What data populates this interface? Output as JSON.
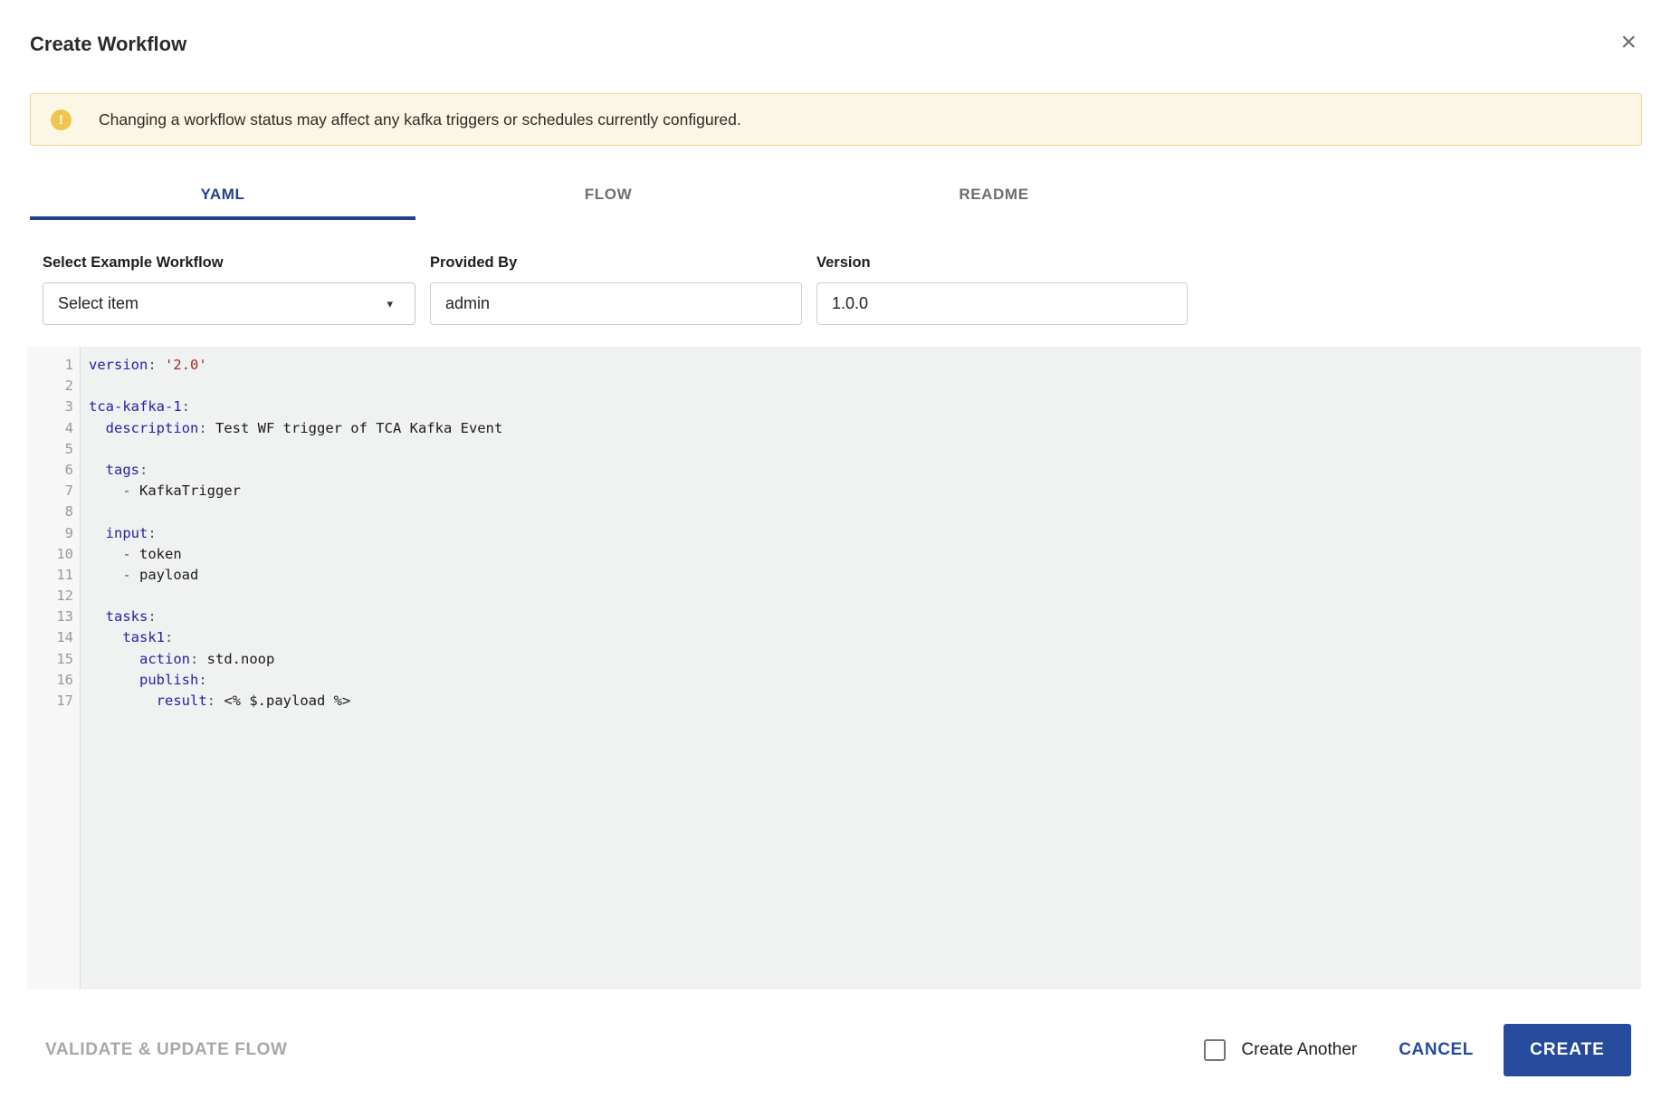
{
  "modal": {
    "title": "Create Workflow",
    "close_icon": "×"
  },
  "warning": {
    "icon": "!",
    "text": "Changing a workflow status may affect any kafka triggers or schedules currently configured."
  },
  "tabs": [
    {
      "label": "YAML",
      "active": true
    },
    {
      "label": "FLOW",
      "active": false
    },
    {
      "label": "README",
      "active": false
    }
  ],
  "form": {
    "example_workflow": {
      "label": "Select Example Workflow",
      "value": "Select item",
      "caret": "▾"
    },
    "provided_by": {
      "label": "Provided By",
      "value": "admin"
    },
    "version": {
      "label": "Version",
      "value": "1.0.0"
    }
  },
  "editor": {
    "lines": [
      {
        "num": "1",
        "tokens": [
          {
            "t": "version",
            "c": "key"
          },
          {
            "t": ":",
            "c": "meta"
          },
          {
            "t": " ",
            "c": "plain"
          },
          {
            "t": "'2.0'",
            "c": "string"
          }
        ]
      },
      {
        "num": "2",
        "tokens": []
      },
      {
        "num": "3",
        "tokens": [
          {
            "t": "tca-kafka-1",
            "c": "key"
          },
          {
            "t": ":",
            "c": "meta"
          }
        ]
      },
      {
        "num": "4",
        "tokens": [
          {
            "t": "  ",
            "c": "plain"
          },
          {
            "t": "description",
            "c": "key"
          },
          {
            "t": ":",
            "c": "meta"
          },
          {
            "t": " Test WF trigger of TCA Kafka Event",
            "c": "plain"
          }
        ]
      },
      {
        "num": "5",
        "tokens": []
      },
      {
        "num": "6",
        "tokens": [
          {
            "t": "  ",
            "c": "plain"
          },
          {
            "t": "tags",
            "c": "key"
          },
          {
            "t": ":",
            "c": "meta"
          }
        ]
      },
      {
        "num": "7",
        "tokens": [
          {
            "t": "    ",
            "c": "plain"
          },
          {
            "t": "-",
            "c": "meta"
          },
          {
            "t": " KafkaTrigger",
            "c": "plain"
          }
        ]
      },
      {
        "num": "8",
        "tokens": []
      },
      {
        "num": "9",
        "tokens": [
          {
            "t": "  ",
            "c": "plain"
          },
          {
            "t": "input",
            "c": "key"
          },
          {
            "t": ":",
            "c": "meta"
          }
        ]
      },
      {
        "num": "10",
        "tokens": [
          {
            "t": "    ",
            "c": "plain"
          },
          {
            "t": "-",
            "c": "meta"
          },
          {
            "t": " token",
            "c": "plain"
          }
        ]
      },
      {
        "num": "11",
        "tokens": [
          {
            "t": "    ",
            "c": "plain"
          },
          {
            "t": "-",
            "c": "meta"
          },
          {
            "t": " payload",
            "c": "plain"
          }
        ]
      },
      {
        "num": "12",
        "tokens": []
      },
      {
        "num": "13",
        "tokens": [
          {
            "t": "  ",
            "c": "plain"
          },
          {
            "t": "tasks",
            "c": "key"
          },
          {
            "t": ":",
            "c": "meta"
          }
        ]
      },
      {
        "num": "14",
        "tokens": [
          {
            "t": "    ",
            "c": "plain"
          },
          {
            "t": "task1",
            "c": "key"
          },
          {
            "t": ":",
            "c": "meta"
          }
        ]
      },
      {
        "num": "15",
        "tokens": [
          {
            "t": "      ",
            "c": "plain"
          },
          {
            "t": "action",
            "c": "key"
          },
          {
            "t": ":",
            "c": "meta"
          },
          {
            "t": " std.noop",
            "c": "plain"
          }
        ]
      },
      {
        "num": "16",
        "tokens": [
          {
            "t": "      ",
            "c": "plain"
          },
          {
            "t": "publish",
            "c": "key"
          },
          {
            "t": ":",
            "c": "meta"
          }
        ]
      },
      {
        "num": "17",
        "tokens": [
          {
            "t": "        ",
            "c": "plain"
          },
          {
            "t": "result",
            "c": "key"
          },
          {
            "t": ":",
            "c": "meta"
          },
          {
            "t": " <% $.payload %>",
            "c": "plain"
          }
        ]
      }
    ]
  },
  "footer": {
    "validate_label": "VALIDATE & UPDATE FLOW",
    "create_another_label": "Create Another",
    "cancel_label": "CANCEL",
    "create_label": "CREATE"
  },
  "colors": {
    "accent": "#274b9c",
    "accent_dark": "#24418e",
    "warning_bg": "#fcf6e4",
    "warning_border": "#ecd388",
    "warning_icon": "#efc54f",
    "code_key": "#2823a5",
    "code_meta": "#555555",
    "code_string": "#a52a21",
    "editor_gutter_bg": "#f7f7f7",
    "editor_bg": "#f0f1f1"
  }
}
